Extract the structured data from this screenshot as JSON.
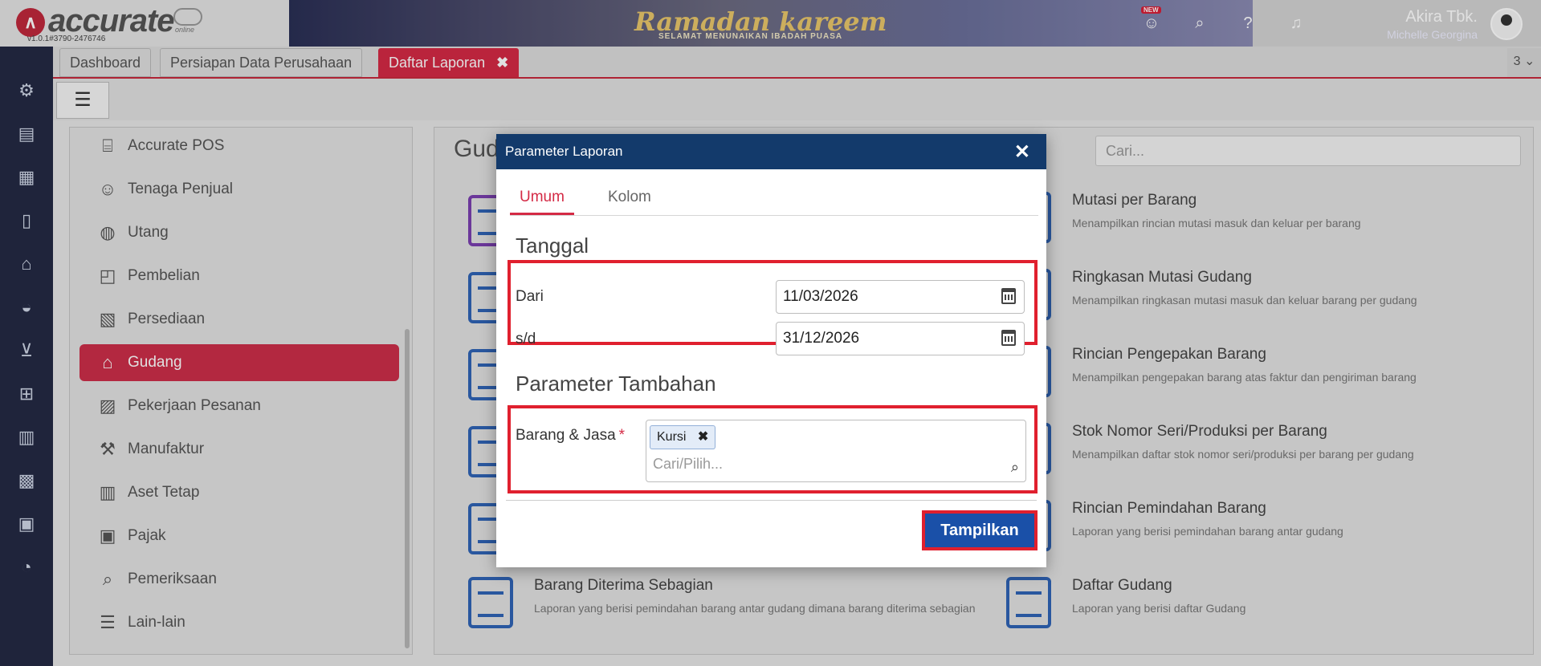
{
  "header": {
    "logo_text": "accurate",
    "logo_online": "online",
    "version": "v1.0.1#3790-2476746",
    "banner_title": "Ramadan kareem",
    "banner_sub": "SELAMAT MENUNAIKAN IBADAH PUASA",
    "new_badge": "NEW",
    "user_name": "Akira Tbk.",
    "user_sub": "Michelle Georgina"
  },
  "tabs": [
    {
      "label": "Dashboard"
    },
    {
      "label": "Persiapan Data Perusahaan"
    },
    {
      "label": "Daftar Laporan",
      "close": "✖"
    }
  ],
  "tab_count": "3 ⌄",
  "sidebar": {
    "items": [
      {
        "label": "Accurate POS",
        "icon": "pos-icon"
      },
      {
        "label": "Tenaga Penjual",
        "icon": "salesperson-icon"
      },
      {
        "label": "Utang",
        "icon": "debt-icon"
      },
      {
        "label": "Pembelian",
        "icon": "purchase-bag-icon"
      },
      {
        "label": "Persediaan",
        "icon": "inventory-icon"
      },
      {
        "label": "Gudang",
        "icon": "warehouse-icon"
      },
      {
        "label": "Pekerjaan Pesanan",
        "icon": "job-order-icon"
      },
      {
        "label": "Manufaktur",
        "icon": "manufacture-icon"
      },
      {
        "label": "Aset Tetap",
        "icon": "fixed-asset-icon"
      },
      {
        "label": "Pajak",
        "icon": "tax-icon"
      },
      {
        "label": "Pemeriksaan",
        "icon": "audit-icon"
      },
      {
        "label": "Lain-lain",
        "icon": "other-icon"
      }
    ]
  },
  "main": {
    "title": "Gud",
    "search_placeholder": "Cari...",
    "reports": [
      {
        "title": "Mutasi per Barang",
        "desc": "Menampilkan rincian mutasi masuk dan keluar per barang"
      },
      {
        "title": "Ringkasan Mutasi Gudang",
        "desc": "Menampilkan ringkasan mutasi masuk dan keluar barang per gudang"
      },
      {
        "title": "Rincian Pengepakan Barang",
        "desc": "Menampilkan pengepakan barang atas faktur dan pengiriman barang"
      },
      {
        "title": "Stok Nomor Seri/Produksi per Barang",
        "desc": "Menampilkan daftar stok nomor seri/produksi per barang per gudang"
      },
      {
        "title": "Rincian Pemindahan Barang",
        "desc": "Laporan yang berisi pemindahan barang antar gudang"
      },
      {
        "title": "Daftar Gudang",
        "desc": "Laporan yang berisi daftar Gudang"
      },
      {
        "title": "Barang Diterima Sebagian",
        "desc": "Laporan yang berisi pemindahan barang antar gudang dimana barang diterima sebagian"
      }
    ]
  },
  "modal": {
    "title": "Parameter Laporan",
    "close": "✕",
    "tabs": [
      "Umum",
      "Kolom"
    ],
    "section_date": "Tanggal",
    "from_label": "Dari",
    "from_value": "11/03/2026",
    "to_label": "s/d",
    "to_value": "31/12/2026",
    "section_extra": "Parameter Tambahan",
    "items_label": "Barang & Jasa",
    "required_mark": "*",
    "selected_chip": "Kursi",
    "chip_remove": "✖",
    "items_placeholder": "Cari/Pilih...",
    "submit": "Tampilkan"
  },
  "colors": {
    "accent": "#d42a45",
    "modal_header": "#133a6b",
    "primary_button": "#1a50a8",
    "highlight": "#e0202e"
  }
}
